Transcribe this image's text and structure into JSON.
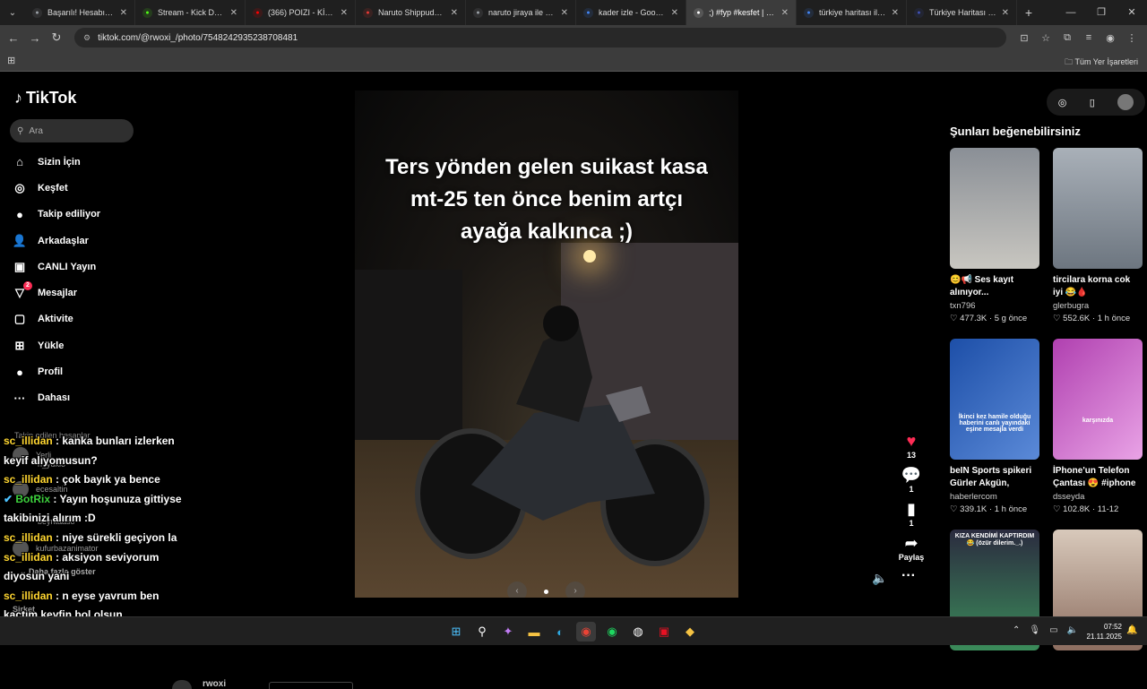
{
  "browser": {
    "tabs": [
      {
        "title": "Başarılı! Hesabın yönt",
        "icon": "globe-icon",
        "color": "#9aa0a6",
        "active": false
      },
      {
        "title": "Stream - Kick Dashbo",
        "icon": "kick-icon",
        "color": "#53fc18",
        "active": false
      },
      {
        "title": "(366) POIZI - KİMSELE",
        "icon": "youtube-icon",
        "color": "#ff0000",
        "active": false
      },
      {
        "title": "Naruto Shippuden 1",
        "icon": "anime-icon",
        "color": "#e53935",
        "active": false
      },
      {
        "title": "naruto jiraya ile kaçm",
        "icon": "globe-icon",
        "color": "#9aa0a6",
        "active": false
      },
      {
        "title": "kader izle - Google'd",
        "icon": "google-icon",
        "color": "#4285f4",
        "active": false
      },
      {
        "title": ";) #fyp #kesfet | TikTo",
        "icon": "tiktok-icon",
        "color": "#ffffff",
        "active": true
      },
      {
        "title": "türkiye haritası iller -",
        "icon": "google-icon",
        "color": "#4285f4",
        "active": false
      },
      {
        "title": "Türkiye Haritası - Tür",
        "icon": "flag-icon",
        "color": "#3f51b5",
        "active": false
      }
    ],
    "url": "tiktok.com/@rwoxi_/photo/7548242935238708481",
    "all_bookmarks": "Tüm Yer İşaretleri"
  },
  "tiktok": {
    "logo": "TikTok",
    "search_placeholder": "Ara",
    "nav": [
      {
        "label": "Sizin İçin",
        "icon": "home-icon",
        "glyph": "⌂"
      },
      {
        "label": "Keşfet",
        "icon": "compass-icon",
        "glyph": "◎"
      },
      {
        "label": "Takip ediliyor",
        "icon": "following-avatar-icon",
        "glyph": "●"
      },
      {
        "label": "Arkadaşlar",
        "icon": "friends-icon",
        "glyph": "👤"
      },
      {
        "label": "CANLI Yayın",
        "icon": "live-icon",
        "glyph": "▣"
      },
      {
        "label": "Mesajlar",
        "icon": "messages-icon",
        "glyph": "▽",
        "badge": "2"
      },
      {
        "label": "Aktivite",
        "icon": "activity-icon",
        "glyph": "▢"
      },
      {
        "label": "Yükle",
        "icon": "upload-icon",
        "glyph": "⊞"
      },
      {
        "label": "Profil",
        "icon": "profile-icon",
        "glyph": "●"
      },
      {
        "label": "Dahası",
        "icon": "more-icon",
        "glyph": "···"
      }
    ],
    "following_heading": "Takip edilen hesaplar",
    "following": [
      "Yerli",
      "rl_yukio",
      "ecesaltin",
      "beyntaaso",
      "kufurbazanimator"
    ],
    "show_more": "Daha fazla göster",
    "company": "Şirket",
    "post": {
      "caption_lines": [
        "Ters yönden gelen suikast kasa",
        "mt-25 ten önce benim artçı",
        "ayağa kalkınca ;)"
      ],
      "likes": "13",
      "comments": "1",
      "saves": "1",
      "share_label": "Paylaş",
      "author": "rwoxi"
    },
    "suggestions_title": "Şunları beğenebilirsiniz",
    "suggestions": [
      {
        "desc": "😊📢 Ses kayıt alınıyor...",
        "user": "txn796",
        "likes": "477.3K",
        "time": "5 g önce",
        "overlay": ""
      },
      {
        "desc": "tircilara korna cok iyi 😂🩸",
        "user": "glerbugra",
        "likes": "552.6K",
        "time": "1 h önce",
        "overlay": ""
      },
      {
        "desc": "beIN Sports spikeri Gürler Akgün, canlı...",
        "user": "haberlercom",
        "likes": "339.1K",
        "time": "1 h önce",
        "overlay": "İkinci kez hamile olduğu haberini canlı yayındaki eşine mesajla verdi"
      },
      {
        "desc": "İPhone'un Telefon Çantası 😍 #iphone",
        "user": "dsseyda",
        "likes": "102.8K",
        "time": "11-12",
        "overlay": "karşınızda"
      },
      {
        "desc": "",
        "user": "",
        "likes": "",
        "time": "",
        "overlay": "KIZA KENDİMİ KAPTIRDIM😂 (özür dilerim._.)"
      },
      {
        "desc": "",
        "user": "",
        "likes": "",
        "time": "",
        "overlay": ""
      }
    ]
  },
  "chat": [
    {
      "user": "sc_illidan",
      "msg": " : kanka bunları izlerken keyif alıyomusun?",
      "color": "#ffd630"
    },
    {
      "user": "sc_illidan",
      "msg": " : çok bayık ya bence",
      "color": "#ffd630"
    },
    {
      "user": "BotRix",
      "msg": " : Yayın hoşunuza gittiyse takibinizi alırım :D",
      "color": "#3dd13d"
    },
    {
      "user": "sc_illidan",
      "msg": " : niye sürekli geçiyon la",
      "color": "#ffd630"
    },
    {
      "user": "sc_illidan",
      "msg": " : aksiyon seviyorum diyosun yani",
      "color": "#ffd630"
    },
    {
      "user": "sc_illidan",
      "msg": " : n eyse yavrum ben kaçtım keyfin bol olsun",
      "color": "#ffd630"
    }
  ],
  "taskbar": {
    "time": "07:52",
    "date": "21.11.2025"
  }
}
